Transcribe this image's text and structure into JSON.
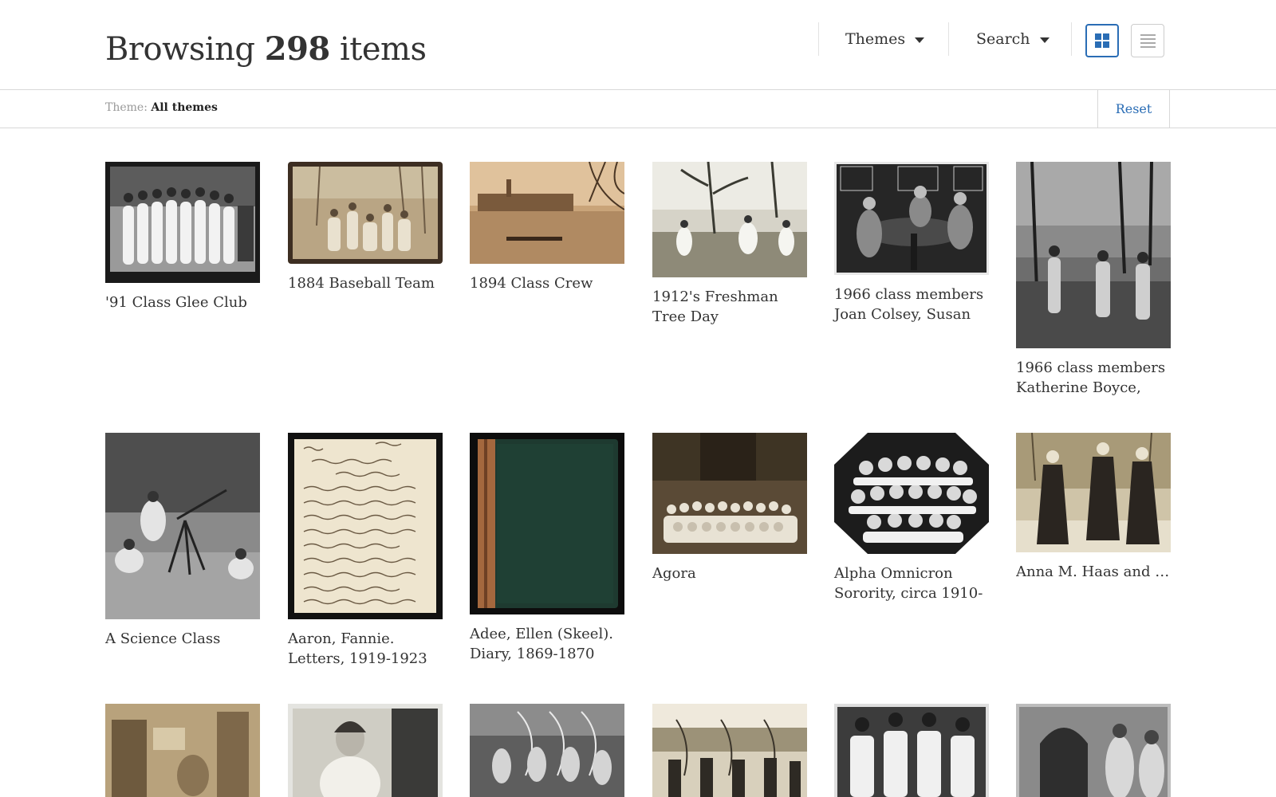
{
  "header": {
    "title_prefix": "Browsing",
    "count": "298",
    "title_suffix": "items",
    "themes_label": "Themes",
    "search_label": "Search"
  },
  "filter": {
    "label": "Theme:",
    "value": "All themes",
    "reset_label": "Reset"
  },
  "colors": {
    "accent": "#2a6db5",
    "text": "#333333",
    "border": "#d8d8d8"
  },
  "items": [
    {
      "title": "'91 Class Glee Club",
      "thumb": "photo-bw-dark-frame"
    },
    {
      "title": "1884 Baseball Team",
      "thumb": "photo-sepia-frame"
    },
    {
      "title": "1894 Class Crew",
      "thumb": "photo-sepia"
    },
    {
      "title": "1912's Freshman Tree Day",
      "thumb": "photo-bw-light"
    },
    {
      "title": "1966 class members Joan Colsey, Susan",
      "thumb": "photo-bw"
    },
    {
      "title": "1966 class members Katherine Boyce,",
      "thumb": "photo-bw"
    },
    {
      "title": "A Science Class",
      "thumb": "photo-bw"
    },
    {
      "title": "Aaron, Fannie. Letters, 1919-1923",
      "thumb": "handwritten-letter"
    },
    {
      "title": "Adee, Ellen (Skeel). Diary, 1869-1870",
      "thumb": "green-book"
    },
    {
      "title": "Agora",
      "thumb": "photo-sepia"
    },
    {
      "title": "Alpha Omnicron Sorority, circa 1910-",
      "thumb": "photo-bw-octagon"
    },
    {
      "title": "Anna M. Haas and others at the Bryn Mawr College",
      "thumb": "photo-sepia-light"
    },
    {
      "title": "",
      "thumb": "photo-sepia"
    },
    {
      "title": "",
      "thumb": "photo-bw-light"
    },
    {
      "title": "",
      "thumb": "photo-bw"
    },
    {
      "title": "",
      "thumb": "photo-sepia-light"
    },
    {
      "title": "",
      "thumb": "photo-bw"
    },
    {
      "title": "",
      "thumb": "photo-bw"
    }
  ]
}
